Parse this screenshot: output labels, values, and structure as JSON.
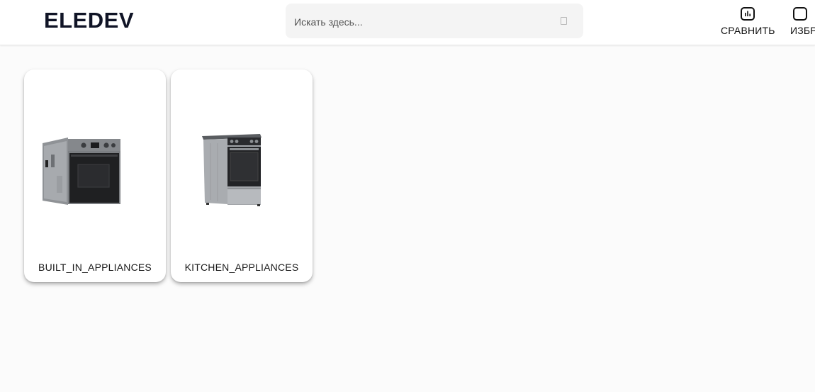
{
  "header": {
    "logo": "ELEDEV",
    "search": {
      "placeholder": "Искать здесь...",
      "value": "",
      "icon": "search-icon"
    },
    "actions": [
      {
        "label": "СРАВНИТЬ",
        "icon": "compare-chart-icon"
      },
      {
        "label": "ИЗБР",
        "icon": "favorites-icon"
      }
    ]
  },
  "categories": [
    {
      "label": "BUILT_IN_APPLIANCES",
      "image": "built-in-oven"
    },
    {
      "label": "KITCHEN_APPLIANCES",
      "image": "electric-stove"
    }
  ],
  "colors": {
    "background": "#fbfbfb",
    "header_bg": "#ffffff",
    "search_bg": "#f4f4f4",
    "logo": "#101426"
  }
}
